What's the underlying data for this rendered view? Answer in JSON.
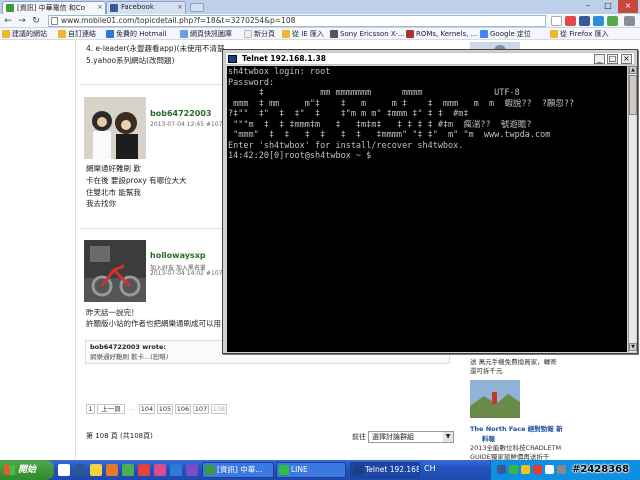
{
  "browser": {
    "tabs": [
      {
        "label": "[資訊] 中華電信 和Co",
        "color": "#3b9a3b",
        "active": true
      },
      {
        "label": "Facebook",
        "color": "#3b5998",
        "active": false
      }
    ],
    "url": "www.mobile01.com/topicdetail.php?f=18&t=3270254&p=108",
    "bookmarks": [
      "建議的網站",
      "自訂連結",
      "免費的 Hotmail",
      "網頁快訊圖庫",
      "新分頁",
      "從 IE 匯入",
      "Sony Ericsson X-...",
      "ROMs, Kernels, ...",
      "Google 定位",
      "從 Firefox 匯入"
    ]
  },
  "forum": {
    "prev_lines": [
      "4. e-leader(永豐趣看app)(未使用不清楚",
      "5.yahoo系列網站(改問題)"
    ],
    "posts": [
      {
        "username": "bob64722003",
        "time": "2013-07-04 12:45 #1072",
        "lines": [
          "網樂通好難刷 歎",
          "卡在後 要設proxy 有哪位大大",
          "住雙北市 能幫我",
          "我去找你"
        ]
      },
      {
        "username": "hollowaysxp",
        "sub": "加入好友 加入黑名單",
        "time": "2013-07-04 14:02 #1073",
        "lines": [
          "昨天話一說完！",
          "許願版小站的作者也把網樂通刷成可以用"
        ]
      }
    ],
    "quote": {
      "title": "bob64722003 wrote:",
      "body": "網樂通好難刷 歎卡...(恕略)"
    },
    "pager": [
      "1",
      "上一頁",
      "...",
      "104",
      "105",
      "106",
      "107",
      "108"
    ],
    "page_info": "第 108 頁 (共108頁)",
    "goto_label": "前往",
    "goto_select": "選擇討論群組"
  },
  "sidebar": {
    "text1": [
      "送 萬元手機免費換買家，轉寄",
      "還可拆千元"
    ],
    "link": "The North Face 絕對勁報 新",
    "link2": "料報",
    "text2": [
      "2013全能數位科技CRADLETM",
      "GUIDE獨家搶鮮價再送折千"
    ]
  },
  "telnet": {
    "title": "Telnet 192.168.1.38",
    "lines": [
      "sh4twbox login: root",
      "Password:",
      "      ‡           mm mmmmmmm      mmmm              UTF-8",
      " mmm  ‡ mm     m\"‡    ‡   m     m ‡    ‡  mmm   m  m  蝦說??  ?願忽??",
      "?‡\"\"  ‡\"  ‡  ‡\"  ‡    ‡\"m m m\" ‡mmm ‡\" ‡ ‡  #m‡",
      " \"\"\"m  ‡  ‡ ‡mmm‡m   ‡   ‡m‡m‡   ‡ ‡ ‡ ‡ #‡m  瘋湍??  號遊瞻?",
      " \"mmm\"  ‡  ‡   ‡  ‡   ‡  ‡   ‡mmmm\" \"‡ ‡\"  m\" \"m  www.twpda.com",
      "Enter 'sh4twbox' for install/recover sh4twbox.",
      "14:42:20[0]root@sh4twbox ~ $"
    ]
  },
  "taskbar": {
    "start_label": "開始",
    "tasks": [
      {
        "label": "[資訊] 中華...",
        "color": "#3b9a3b"
      },
      {
        "label": "LINE",
        "color": "#2fbf3f"
      },
      {
        "label": "Telnet 192.168...",
        "color": "#1d3f86"
      }
    ],
    "language": "CH",
    "watermark": "#2428368"
  },
  "colors": {
    "accent": "#3a6bd5",
    "terminal_bg": "#000000",
    "terminal_fg": "#c0c0c0",
    "username": "#2a6a2a"
  }
}
